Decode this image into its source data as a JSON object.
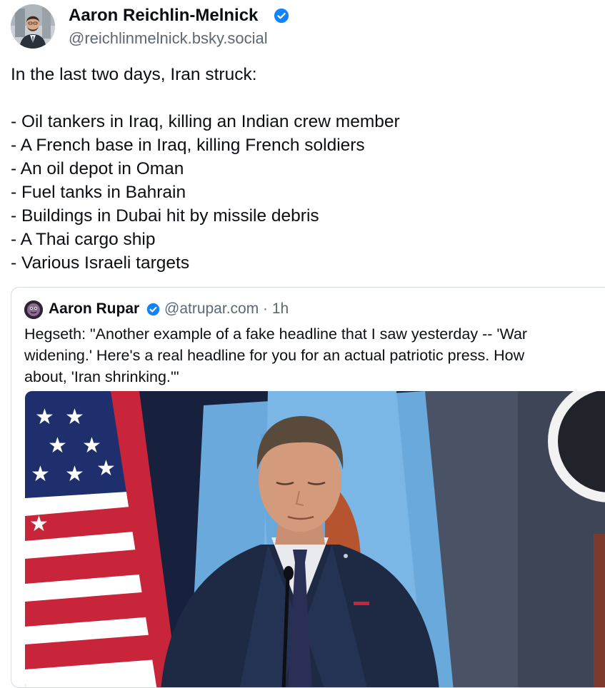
{
  "post": {
    "author": {
      "name": "Aaron Reichlin-Melnick",
      "handle": "@reichlinmelnick.bsky.social",
      "verified_icon": "verified-badge-icon",
      "avatar": "avatar-photo"
    },
    "text_lines": [
      "In the last two days, Iran struck:",
      "",
      "- Oil tankers in Iraq, killing an Indian crew member",
      "- A French base in Iraq, killing French soldiers",
      "- An oil depot in Oman",
      "- Fuel tanks in Bahrain",
      "- Buildings in Dubai hit by missile debris",
      "- A Thai cargo ship",
      "- Various Israeli targets"
    ],
    "quote": {
      "author_name": "Aaron Rupar",
      "handle": "@atrupar.com",
      "separator": "·",
      "time": "1h",
      "meta": "@atrupar.com · 1h",
      "text_lines": [
        "Hegseth: \"Another example of a fake headline that I saw yesterday -- 'War",
        "widening.' Here's a real headline for you for an actual patriotic press. How",
        "about, 'Iran shrinking.'\""
      ],
      "media": "video-still-image"
    }
  },
  "colors": {
    "text": "#0b0f14",
    "muted": "#5c6873",
    "verified": "#1083fe",
    "border": "#d4dbe2"
  }
}
